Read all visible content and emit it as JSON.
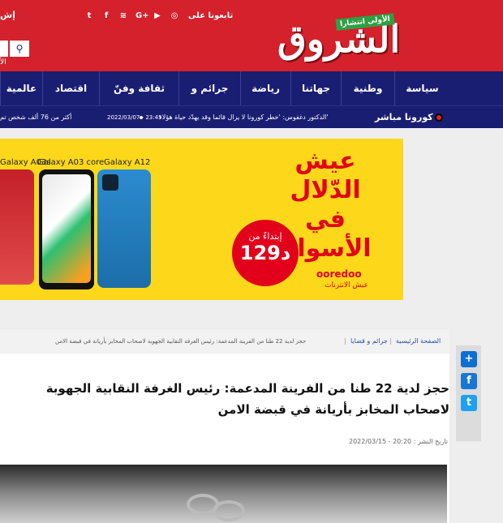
{
  "header": {
    "follow_label": "تابعونا على",
    "logo_text": "الشروق",
    "logo_tagline": "الأولى انتشارا",
    "edge_top_text": "إش",
    "edge_bottom_text": "الأ",
    "social_icons": [
      "instagram-icon",
      "youtube-icon",
      "google-plus-icon",
      "rss-icon",
      "facebook-icon",
      "twitter-icon"
    ],
    "social_glyphs": [
      "◎",
      "▶",
      "G+",
      "≋",
      "f",
      "t"
    ],
    "search_glyph": "⚲",
    "brand_color": "#d4212b",
    "nav_color": "#1a1e73"
  },
  "nav": {
    "items": [
      "سياسة",
      "وطنية",
      "جهاتنا",
      "رياضة",
      "جرائم و قضايا",
      "ثقافة وفنّ",
      "اقتصاد",
      "عالمية"
    ]
  },
  "ticker": {
    "label": "كورونا مباشر",
    "headline": "الدكتور دغفوس: 'خطر كورونا لا يزال قائما وقد يهدّد حياة هؤلاء'",
    "date": "2022/03/07 - 23:45",
    "next_headline": "أكثر من 76 ألف شخص تم"
  },
  "ad": {
    "phones": [
      "Galaxy A03s",
      "Galaxy A03 core",
      "Galaxy A12"
    ],
    "headline_line1": "عيش الدّلال",
    "headline_line2": "في الأسوام",
    "price_prefix": "إبتداءً من",
    "price": "129د",
    "brand": "ooredoo",
    "brand_tagline": "عيش الانترنات",
    "brand_color": "#e2001a",
    "background": "#fdd81a"
  },
  "breadcrumb": {
    "home": "الصفحة الرئيسية",
    "category": "جرائم و قضايا",
    "current": "حجز لدية 22 طنا من الفرينة المدعمة: رئيس الغرفة النقابية الجهوبة لاصحاب المخابز بأريانة في قبضة الامن"
  },
  "article": {
    "title": "حجز لدية 22 طنا من الفرينة المدعمة: رئيس الغرفة النقابية الجهوبة لاصحاب المخابز بأريانة في قبضة الامن",
    "pub_date": "تاريخ النشر : 20:20 - 2022/03/15"
  },
  "share": {
    "buttons": [
      {
        "name": "share-plus",
        "glyph": "+",
        "color": "#0d6fd1"
      },
      {
        "name": "facebook",
        "glyph": "f",
        "color": "#1877d4"
      },
      {
        "name": "twitter",
        "glyph": "t",
        "color": "#1da1f2"
      }
    ]
  }
}
